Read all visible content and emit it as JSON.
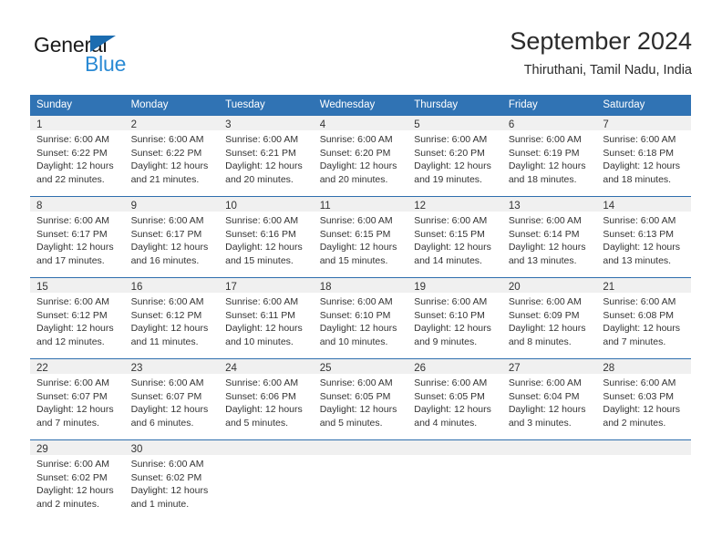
{
  "brand": {
    "name_part1": "General",
    "name_part2": "Blue",
    "color_dark": "#1a1a1a",
    "color_blue": "#2a8ad4",
    "triangle_color": "#1b6cb0"
  },
  "header": {
    "month_title": "September 2024",
    "location": "Thiruthani, Tamil Nadu, India"
  },
  "theme": {
    "header_bg": "#3073b4",
    "header_text": "#ffffff",
    "daynum_band_bg": "#f0f0f0",
    "row_border": "#2f6fae",
    "body_text": "#333333"
  },
  "weekday_headers": [
    "Sunday",
    "Monday",
    "Tuesday",
    "Wednesday",
    "Thursday",
    "Friday",
    "Saturday"
  ],
  "weeks": [
    [
      {
        "day": "1",
        "sunrise": "Sunrise: 6:00 AM",
        "sunset": "Sunset: 6:22 PM",
        "daylight_line1": "Daylight: 12 hours",
        "daylight_line2": "and 22 minutes."
      },
      {
        "day": "2",
        "sunrise": "Sunrise: 6:00 AM",
        "sunset": "Sunset: 6:22 PM",
        "daylight_line1": "Daylight: 12 hours",
        "daylight_line2": "and 21 minutes."
      },
      {
        "day": "3",
        "sunrise": "Sunrise: 6:00 AM",
        "sunset": "Sunset: 6:21 PM",
        "daylight_line1": "Daylight: 12 hours",
        "daylight_line2": "and 20 minutes."
      },
      {
        "day": "4",
        "sunrise": "Sunrise: 6:00 AM",
        "sunset": "Sunset: 6:20 PM",
        "daylight_line1": "Daylight: 12 hours",
        "daylight_line2": "and 20 minutes."
      },
      {
        "day": "5",
        "sunrise": "Sunrise: 6:00 AM",
        "sunset": "Sunset: 6:20 PM",
        "daylight_line1": "Daylight: 12 hours",
        "daylight_line2": "and 19 minutes."
      },
      {
        "day": "6",
        "sunrise": "Sunrise: 6:00 AM",
        "sunset": "Sunset: 6:19 PM",
        "daylight_line1": "Daylight: 12 hours",
        "daylight_line2": "and 18 minutes."
      },
      {
        "day": "7",
        "sunrise": "Sunrise: 6:00 AM",
        "sunset": "Sunset: 6:18 PM",
        "daylight_line1": "Daylight: 12 hours",
        "daylight_line2": "and 18 minutes."
      }
    ],
    [
      {
        "day": "8",
        "sunrise": "Sunrise: 6:00 AM",
        "sunset": "Sunset: 6:17 PM",
        "daylight_line1": "Daylight: 12 hours",
        "daylight_line2": "and 17 minutes."
      },
      {
        "day": "9",
        "sunrise": "Sunrise: 6:00 AM",
        "sunset": "Sunset: 6:17 PM",
        "daylight_line1": "Daylight: 12 hours",
        "daylight_line2": "and 16 minutes."
      },
      {
        "day": "10",
        "sunrise": "Sunrise: 6:00 AM",
        "sunset": "Sunset: 6:16 PM",
        "daylight_line1": "Daylight: 12 hours",
        "daylight_line2": "and 15 minutes."
      },
      {
        "day": "11",
        "sunrise": "Sunrise: 6:00 AM",
        "sunset": "Sunset: 6:15 PM",
        "daylight_line1": "Daylight: 12 hours",
        "daylight_line2": "and 15 minutes."
      },
      {
        "day": "12",
        "sunrise": "Sunrise: 6:00 AM",
        "sunset": "Sunset: 6:15 PM",
        "daylight_line1": "Daylight: 12 hours",
        "daylight_line2": "and 14 minutes."
      },
      {
        "day": "13",
        "sunrise": "Sunrise: 6:00 AM",
        "sunset": "Sunset: 6:14 PM",
        "daylight_line1": "Daylight: 12 hours",
        "daylight_line2": "and 13 minutes."
      },
      {
        "day": "14",
        "sunrise": "Sunrise: 6:00 AM",
        "sunset": "Sunset: 6:13 PM",
        "daylight_line1": "Daylight: 12 hours",
        "daylight_line2": "and 13 minutes."
      }
    ],
    [
      {
        "day": "15",
        "sunrise": "Sunrise: 6:00 AM",
        "sunset": "Sunset: 6:12 PM",
        "daylight_line1": "Daylight: 12 hours",
        "daylight_line2": "and 12 minutes."
      },
      {
        "day": "16",
        "sunrise": "Sunrise: 6:00 AM",
        "sunset": "Sunset: 6:12 PM",
        "daylight_line1": "Daylight: 12 hours",
        "daylight_line2": "and 11 minutes."
      },
      {
        "day": "17",
        "sunrise": "Sunrise: 6:00 AM",
        "sunset": "Sunset: 6:11 PM",
        "daylight_line1": "Daylight: 12 hours",
        "daylight_line2": "and 10 minutes."
      },
      {
        "day": "18",
        "sunrise": "Sunrise: 6:00 AM",
        "sunset": "Sunset: 6:10 PM",
        "daylight_line1": "Daylight: 12 hours",
        "daylight_line2": "and 10 minutes."
      },
      {
        "day": "19",
        "sunrise": "Sunrise: 6:00 AM",
        "sunset": "Sunset: 6:10 PM",
        "daylight_line1": "Daylight: 12 hours",
        "daylight_line2": "and 9 minutes."
      },
      {
        "day": "20",
        "sunrise": "Sunrise: 6:00 AM",
        "sunset": "Sunset: 6:09 PM",
        "daylight_line1": "Daylight: 12 hours",
        "daylight_line2": "and 8 minutes."
      },
      {
        "day": "21",
        "sunrise": "Sunrise: 6:00 AM",
        "sunset": "Sunset: 6:08 PM",
        "daylight_line1": "Daylight: 12 hours",
        "daylight_line2": "and 7 minutes."
      }
    ],
    [
      {
        "day": "22",
        "sunrise": "Sunrise: 6:00 AM",
        "sunset": "Sunset: 6:07 PM",
        "daylight_line1": "Daylight: 12 hours",
        "daylight_line2": "and 7 minutes."
      },
      {
        "day": "23",
        "sunrise": "Sunrise: 6:00 AM",
        "sunset": "Sunset: 6:07 PM",
        "daylight_line1": "Daylight: 12 hours",
        "daylight_line2": "and 6 minutes."
      },
      {
        "day": "24",
        "sunrise": "Sunrise: 6:00 AM",
        "sunset": "Sunset: 6:06 PM",
        "daylight_line1": "Daylight: 12 hours",
        "daylight_line2": "and 5 minutes."
      },
      {
        "day": "25",
        "sunrise": "Sunrise: 6:00 AM",
        "sunset": "Sunset: 6:05 PM",
        "daylight_line1": "Daylight: 12 hours",
        "daylight_line2": "and 5 minutes."
      },
      {
        "day": "26",
        "sunrise": "Sunrise: 6:00 AM",
        "sunset": "Sunset: 6:05 PM",
        "daylight_line1": "Daylight: 12 hours",
        "daylight_line2": "and 4 minutes."
      },
      {
        "day": "27",
        "sunrise": "Sunrise: 6:00 AM",
        "sunset": "Sunset: 6:04 PM",
        "daylight_line1": "Daylight: 12 hours",
        "daylight_line2": "and 3 minutes."
      },
      {
        "day": "28",
        "sunrise": "Sunrise: 6:00 AM",
        "sunset": "Sunset: 6:03 PM",
        "daylight_line1": "Daylight: 12 hours",
        "daylight_line2": "and 2 minutes."
      }
    ],
    [
      {
        "day": "29",
        "sunrise": "Sunrise: 6:00 AM",
        "sunset": "Sunset: 6:02 PM",
        "daylight_line1": "Daylight: 12 hours",
        "daylight_line2": "and 2 minutes."
      },
      {
        "day": "30",
        "sunrise": "Sunrise: 6:00 AM",
        "sunset": "Sunset: 6:02 PM",
        "daylight_line1": "Daylight: 12 hours",
        "daylight_line2": "and 1 minute."
      },
      {
        "day": "",
        "sunrise": "",
        "sunset": "",
        "daylight_line1": "",
        "daylight_line2": ""
      },
      {
        "day": "",
        "sunrise": "",
        "sunset": "",
        "daylight_line1": "",
        "daylight_line2": ""
      },
      {
        "day": "",
        "sunrise": "",
        "sunset": "",
        "daylight_line1": "",
        "daylight_line2": ""
      },
      {
        "day": "",
        "sunrise": "",
        "sunset": "",
        "daylight_line1": "",
        "daylight_line2": ""
      },
      {
        "day": "",
        "sunrise": "",
        "sunset": "",
        "daylight_line1": "",
        "daylight_line2": ""
      }
    ]
  ]
}
